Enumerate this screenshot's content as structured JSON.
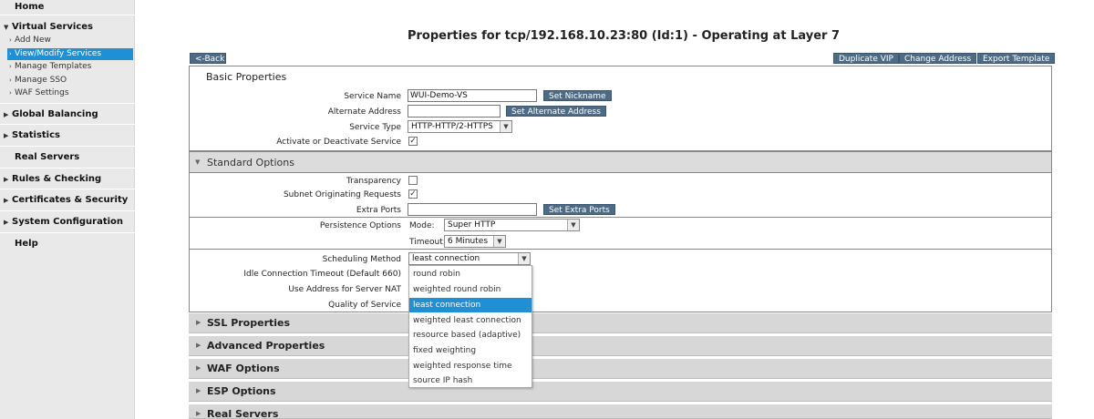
{
  "sidebar": {
    "home": "Home",
    "virtual_services": "Virtual Services",
    "sub_items": [
      "Add New",
      "View/Modify Services",
      "Manage Templates",
      "Manage SSO",
      "WAF Settings"
    ],
    "global_balancing": "Global Balancing",
    "statistics": "Statistics",
    "real_servers": "Real Servers",
    "rules_checking": "Rules & Checking",
    "certificates_security": "Certificates & Security",
    "system_configuration": "System Configuration",
    "help": "Help"
  },
  "page": {
    "title": "Properties for tcp/192.168.10.23:80 (Id:1) - Operating at Layer 7",
    "back_label": "<-Back",
    "duplicate_vip_label": "Duplicate VIP",
    "change_address_label": "Change Address",
    "export_template_label": "Export Template"
  },
  "basic": {
    "header": "Basic Properties",
    "service_name_label": "Service Name",
    "service_name_value": "WUI-Demo-VS",
    "set_nickname_label": "Set Nickname",
    "alternate_address_label": "Alternate Address",
    "alternate_address_value": "",
    "set_alternate_label": "Set Alternate Address",
    "service_type_label": "Service Type",
    "service_type_value": "HTTP-HTTP/2-HTTPS",
    "activate_label": "Activate or Deactivate Service",
    "activate_checked": true
  },
  "standard": {
    "header": "Standard Options",
    "transparency_label": "Transparency",
    "transparency_checked": false,
    "subnet_label": "Subnet Originating Requests",
    "subnet_checked": true,
    "extra_ports_label": "Extra Ports",
    "extra_ports_value": "",
    "set_extra_ports_label": "Set Extra Ports",
    "persistence_label": "Persistence Options",
    "mode_label": "Mode:",
    "mode_value": "Super HTTP",
    "timeout_label": "Timeout:",
    "timeout_value": "6 Minutes",
    "scheduling_label": "Scheduling Method",
    "scheduling_value": "least connection",
    "idle_label": "Idle Connection Timeout (Default 660)",
    "nat_label": "Use Address for Server NAT",
    "qos_label": "Quality of Service",
    "scheduling_options": [
      "round robin",
      "weighted round robin",
      "least connection",
      "weighted least connection",
      "resource based (adaptive)",
      "fixed weighting",
      "weighted response time",
      "source IP hash"
    ],
    "selected_index": 2
  },
  "collapsed_sections": [
    "SSL Properties",
    "Advanced Properties",
    "WAF Options",
    "ESP Options",
    "Real Servers"
  ],
  "icons": {
    "expand": "triangle-right-icon",
    "collapse": "triangle-down-icon",
    "dropdown": "chevron-down-icon",
    "checkbox": "checkmark-icon"
  },
  "colors": {
    "accent": "#1f8fd6",
    "button": "#4e6b86",
    "section_bg": "#d7d7d7"
  }
}
